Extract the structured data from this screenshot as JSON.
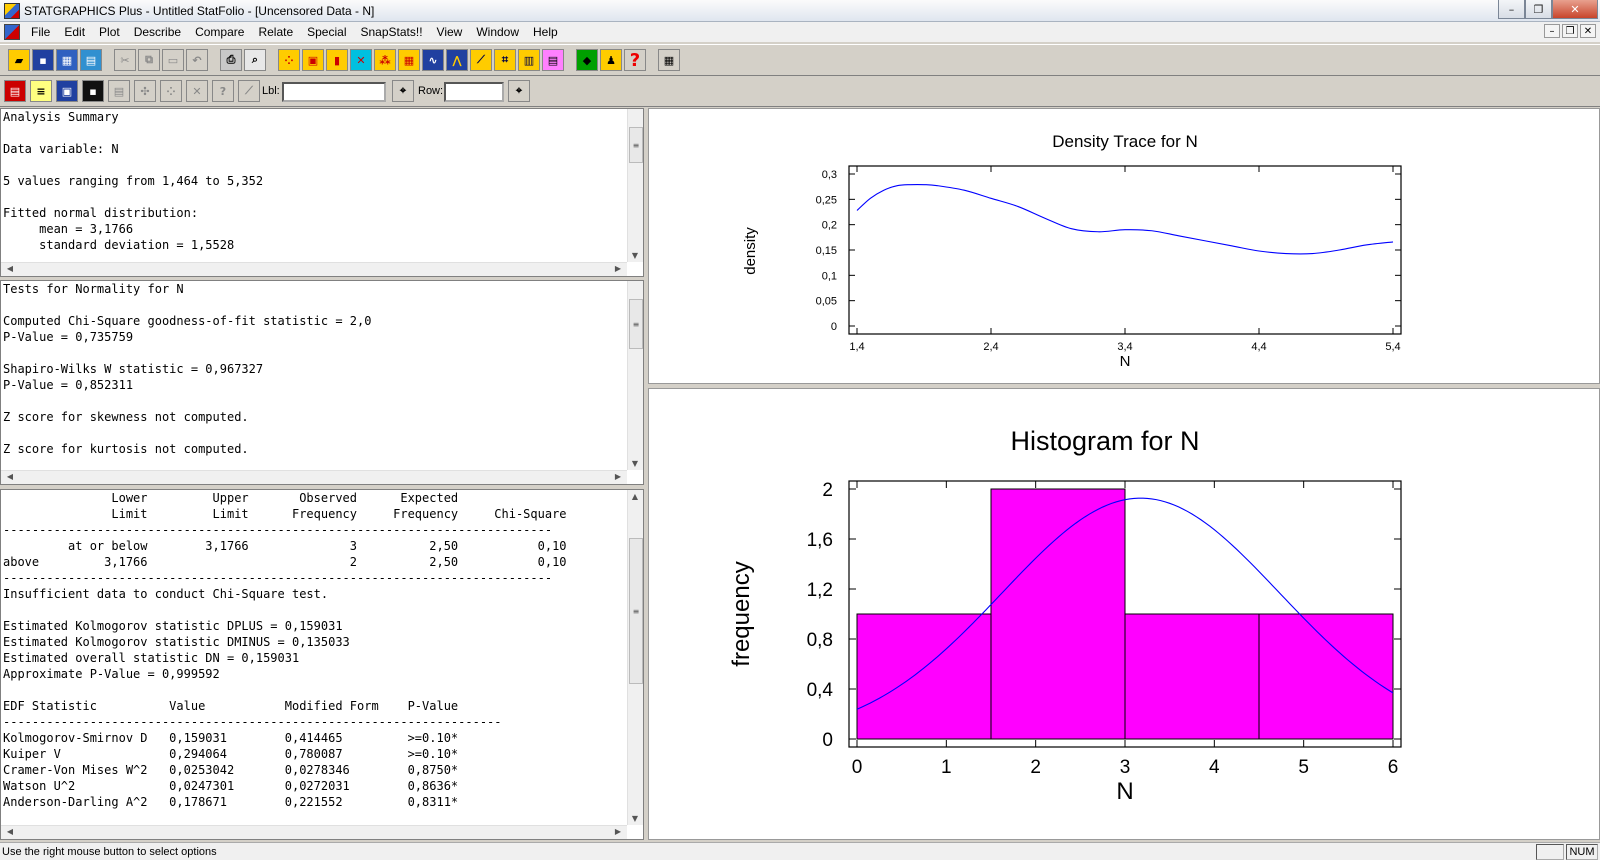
{
  "window": {
    "title": "STATGRAPHICS Plus - Untitled StatFolio - [Uncensored Data - N]",
    "minimize": "–",
    "restore": "❐",
    "close": "✕"
  },
  "menu": [
    "File",
    "Edit",
    "Plot",
    "Describe",
    "Compare",
    "Relate",
    "Special",
    "SnapStats!!",
    "View",
    "Window",
    "Help"
  ],
  "toolbar2": {
    "lbl_label": "Lbl:",
    "row_label": "Row:"
  },
  "panes": {
    "summary": "Analysis Summary\n\nData variable: N\n\n5 values ranging from 1,464 to 5,352\n\nFitted normal distribution:\n     mean = 3,1766\n     standard deviation = 1,5528",
    "normality": "Tests for Normality for N\n\nComputed Chi-Square goodness-of-fit statistic = 2,0\nP-Value = 0,735759\n\nShapiro-Wilks W statistic = 0,967327\nP-Value = 0,852311\n\nZ score for skewness not computed.\n\nZ score for kurtosis not computed.",
    "goodness": "               Lower         Upper       Observed      Expected\n               Limit         Limit      Frequency     Frequency     Chi-Square\n----------------------------------------------------------------------------\n         at or below        3,1766              3          2,50           0,10\nabove         3,1766                            2          2,50           0,10\n----------------------------------------------------------------------------\nInsufficient data to conduct Chi-Square test.\n\nEstimated Kolmogorov statistic DPLUS = 0,159031\nEstimated Kolmogorov statistic DMINUS = 0,135033\nEstimated overall statistic DN = 0,159031\nApproximate P-Value = 0,999592\n\nEDF Statistic          Value           Modified Form    P-Value\n---------------------------------------------------------------------\nKolmogorov-Smirnov D   0,159031        0,414465         >=0.10*\nKuiper V               0,294064        0,780087         >=0.10*\nCramer-Von Mises W^2   0,0253042       0,0278346        0,8750*\nWatson U^2             0,0247301       0,0272031        0,8636*\nAnderson-Darling A^2   0,178671        0,221552         0,8311*"
  },
  "status": {
    "text": "Use the right mouse button to select options",
    "num": "NUM"
  },
  "chart_data": [
    {
      "type": "line",
      "title": "Density Trace for N",
      "xlabel": "N",
      "ylabel": "density",
      "xlim": [
        1.4,
        5.4
      ],
      "ylim": [
        0,
        0.3
      ],
      "xticks": [
        "1,4",
        "2,4",
        "3,4",
        "4,4",
        "5,4"
      ],
      "yticks": [
        "0",
        "0,05",
        "0,1",
        "0,15",
        "0,2",
        "0,25",
        "0,3"
      ],
      "x": [
        1.4,
        1.5,
        1.6,
        1.7,
        1.8,
        1.9,
        2.0,
        2.2,
        2.4,
        2.6,
        2.8,
        3.0,
        3.2,
        3.4,
        3.6,
        3.8,
        4.0,
        4.2,
        4.4,
        4.6,
        4.8,
        5.0,
        5.2,
        5.4
      ],
      "y": [
        0.228,
        0.252,
        0.268,
        0.277,
        0.279,
        0.279,
        0.277,
        0.268,
        0.252,
        0.236,
        0.213,
        0.192,
        0.186,
        0.19,
        0.188,
        0.178,
        0.168,
        0.158,
        0.148,
        0.143,
        0.143,
        0.15,
        0.16,
        0.166
      ],
      "color": "#0000ff"
    },
    {
      "type": "bar",
      "title": "Histogram for N",
      "xlabel": "N",
      "ylabel": "frequency",
      "xlim": [
        0,
        6
      ],
      "ylim": [
        0,
        2
      ],
      "xticks": [
        "0",
        "1",
        "2",
        "3",
        "4",
        "5",
        "6"
      ],
      "yticks": [
        "0",
        "0,4",
        "0,8",
        "1,2",
        "1,6",
        "2"
      ],
      "bins": [
        {
          "from": 0,
          "to": 1.5,
          "value": 1
        },
        {
          "from": 1.5,
          "to": 3,
          "value": 2
        },
        {
          "from": 3,
          "to": 4.5,
          "value": 1
        },
        {
          "from": 4.5,
          "to": 6,
          "value": 1
        }
      ],
      "bar_color": "#ff00ff",
      "normal_curve": {
        "mean": 3.1766,
        "sd": 1.5528,
        "scale": 1.5,
        "color": "#0000ff"
      }
    }
  ]
}
